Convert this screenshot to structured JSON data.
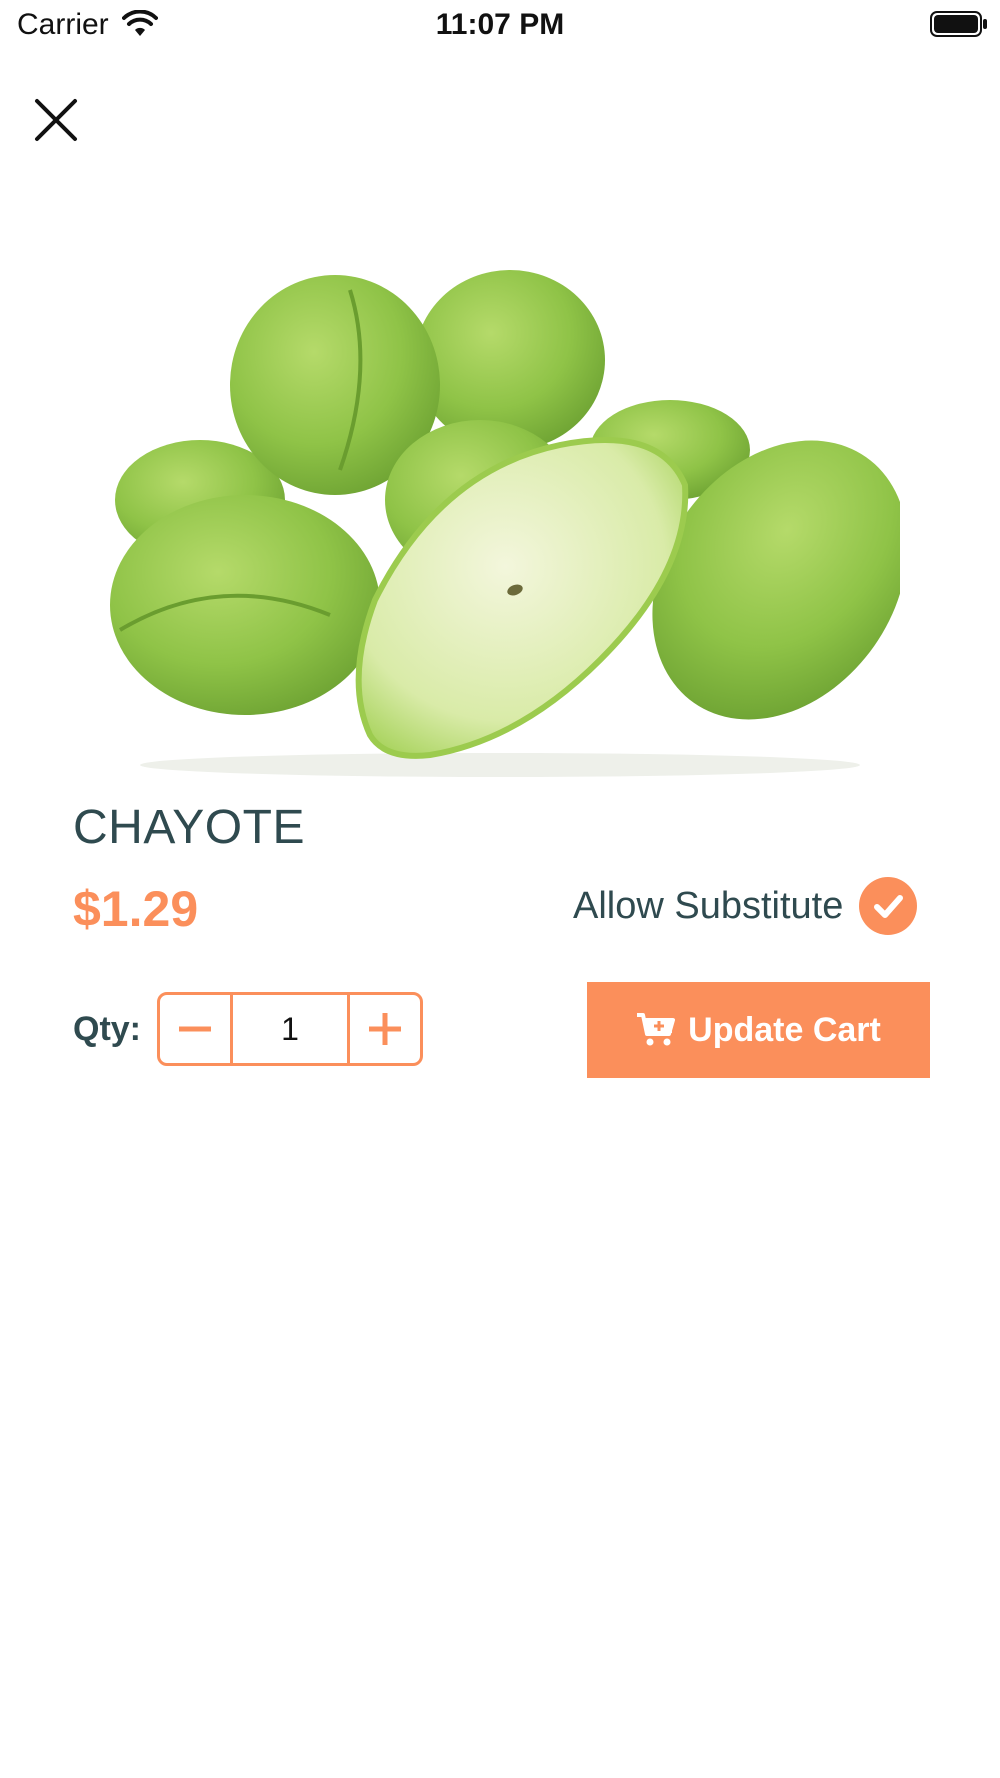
{
  "status_bar": {
    "carrier": "Carrier",
    "time": "11:07 PM",
    "wifi_icon": "wifi-icon",
    "battery_icon": "battery-icon"
  },
  "close_icon": "close-icon",
  "product": {
    "name": "CHAYOTE",
    "price": "$1.29",
    "image_icon": "chayote-image"
  },
  "substitute": {
    "label": "Allow Substitute",
    "checked": true,
    "icon": "check-circle-icon"
  },
  "quantity": {
    "label": "Qty:",
    "value": "1",
    "decrement_icon": "minus-icon",
    "increment_icon": "plus-icon"
  },
  "cart_button": {
    "label": "Update Cart",
    "icon": "cart-plus-icon"
  },
  "colors": {
    "accent": "#fb8f5b",
    "text_dark": "#2f4a4f"
  }
}
